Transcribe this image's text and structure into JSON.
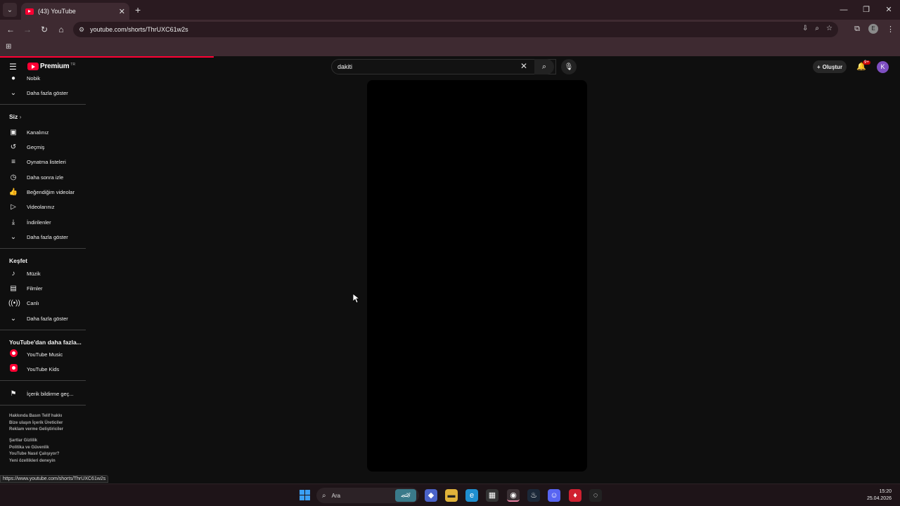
{
  "browser": {
    "tab_title": "(43) YouTube",
    "url": "youtube.com/shorts/ThrUXC61w2s",
    "status_url": "https://www.youtube.com/shorts/ThrUXC61w2s"
  },
  "youtube": {
    "logo_text": "Premium",
    "logo_region": "TR",
    "search_query": "dakiti",
    "create_label": "Oluştur",
    "notification_badge": "9+",
    "avatar_letter": "K"
  },
  "sidebar": {
    "partial_top_item": "Nobik",
    "show_more_1": "Daha fazla göster",
    "you_header": "Siz",
    "you_items": [
      {
        "label": "Kanalınız",
        "icon": "channel-icon"
      },
      {
        "label": "Geçmiş",
        "icon": "history-icon"
      },
      {
        "label": "Oynatma listeleri",
        "icon": "playlists-icon"
      },
      {
        "label": "Daha sonra izle",
        "icon": "watch-later-icon"
      },
      {
        "label": "Beğendiğim videolar",
        "icon": "liked-icon"
      },
      {
        "label": "Videolarınız",
        "icon": "your-videos-icon"
      },
      {
        "label": "İndirilenler",
        "icon": "downloads-icon"
      },
      {
        "label": "Daha fazla göster",
        "icon": "chevron-down-icon"
      }
    ],
    "explore_header": "Keşfet",
    "explore_items": [
      {
        "label": "Müzik",
        "icon": "music-icon"
      },
      {
        "label": "Filmler",
        "icon": "movies-icon"
      },
      {
        "label": "Canlı",
        "icon": "live-icon"
      },
      {
        "label": "Daha fazla göster",
        "icon": "chevron-down-icon"
      }
    ],
    "more_header": "YouTube'dan daha fazla...",
    "more_items": [
      {
        "label": "YouTube Music"
      },
      {
        "label": "YouTube Kids"
      }
    ],
    "report_label": "İçerik bildirme geç...",
    "footer_1": [
      "Hakkında  Basın  Telif hakkı",
      "Bize ulaşın  İçerik Üreticiler",
      "Reklam verme  Geliştiriciler"
    ],
    "footer_2": [
      "Şartlar  Gizlilik",
      "Politika ve Güvenlik",
      "YouTube Nasıl Çalışıyor?",
      "Yeni özellikleri deneyin"
    ]
  },
  "taskbar": {
    "search_label": "Ara",
    "time": "15:20",
    "date": "25.04.2026"
  }
}
